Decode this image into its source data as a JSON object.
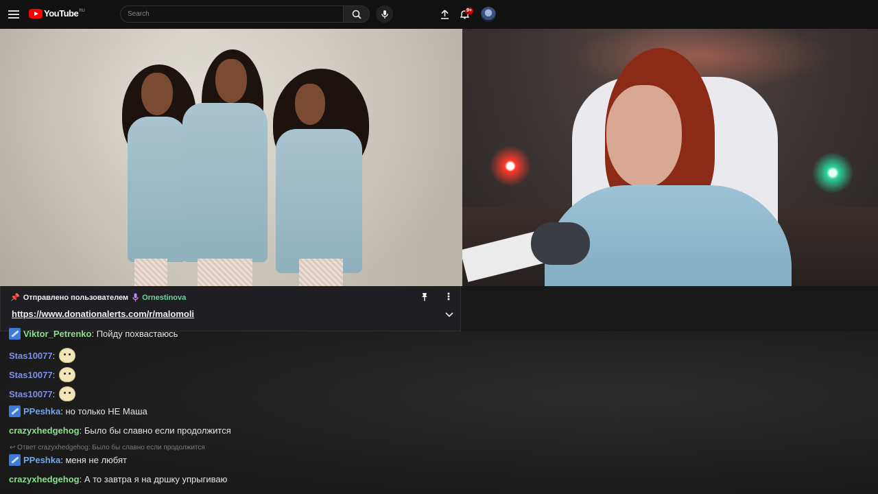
{
  "header": {
    "logo_text": "YouTube",
    "logo_region": "RU",
    "search_placeholder": "Search",
    "notifications_count": "9+",
    "icons": [
      "menu-icon",
      "search-icon",
      "microphone-icon",
      "upload-icon",
      "bell-icon"
    ]
  },
  "pinned": {
    "label": "Отправлено пользователем",
    "user": "Ornestinova",
    "link": "https://www.donationalerts.com/r/malomoli"
  },
  "chat": {
    "messages": [
      {
        "user": "Viktor_Petrenko",
        "text": "Пойду похвастаюсь"
      },
      {
        "user": "Stas10077",
        "text": ""
      },
      {
        "user": "Stas10077",
        "text": ""
      },
      {
        "user": "Stas10077",
        "text": ""
      },
      {
        "user": "PPeshka",
        "text": "но только НЕ Маша"
      },
      {
        "user": "crazyxhedgehog",
        "text": "Было бы славно если продолжится"
      },
      {
        "user": "PPeshka",
        "text": "меня не любят"
      },
      {
        "user": "crazyxhedgehog",
        "text": "А то завтра я на дршку упрыгиваю"
      }
    ],
    "reply_text": "Ответ crazyxhedgehog: Было бы славно если продолжится"
  },
  "colors": {
    "username_green": "#8ce08c",
    "username_blue": "#7f8fe6",
    "username_lightblue": "#6fa8ea",
    "pinned_user": "#6bd49f",
    "badge_red": "#cc0000"
  }
}
